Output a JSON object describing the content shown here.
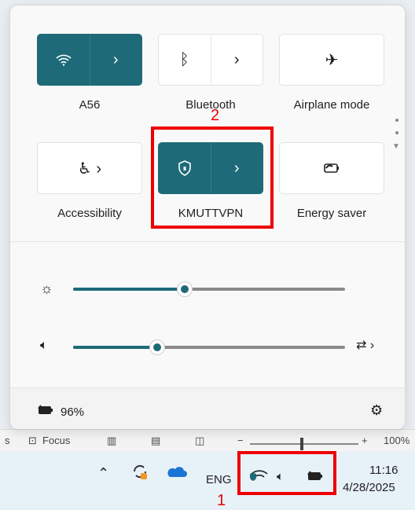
{
  "panel": {
    "tiles": [
      {
        "label": "A56",
        "state": "on"
      },
      {
        "label": "Bluetooth",
        "state": "off"
      },
      {
        "label": "Airplane mode",
        "state": "off"
      },
      {
        "label": "Accessibility",
        "state": "off"
      },
      {
        "label": "KMUTTVPN",
        "state": "on"
      },
      {
        "label": "Energy saver",
        "state": "off"
      }
    ],
    "brightness_level": 0.41,
    "volume_level": 0.31,
    "battery_text": "96%"
  },
  "annotations": {
    "label_1": "1",
    "label_2": "2"
  },
  "app_strip": {
    "left_text": "s",
    "focus_text": "Focus",
    "zoom_text": "100%"
  },
  "taskbar": {
    "language": "ENG",
    "time": "11:16",
    "date": "4/28/2025"
  },
  "colors": {
    "accent": "#1e6a78",
    "highlight": "#e00000"
  }
}
